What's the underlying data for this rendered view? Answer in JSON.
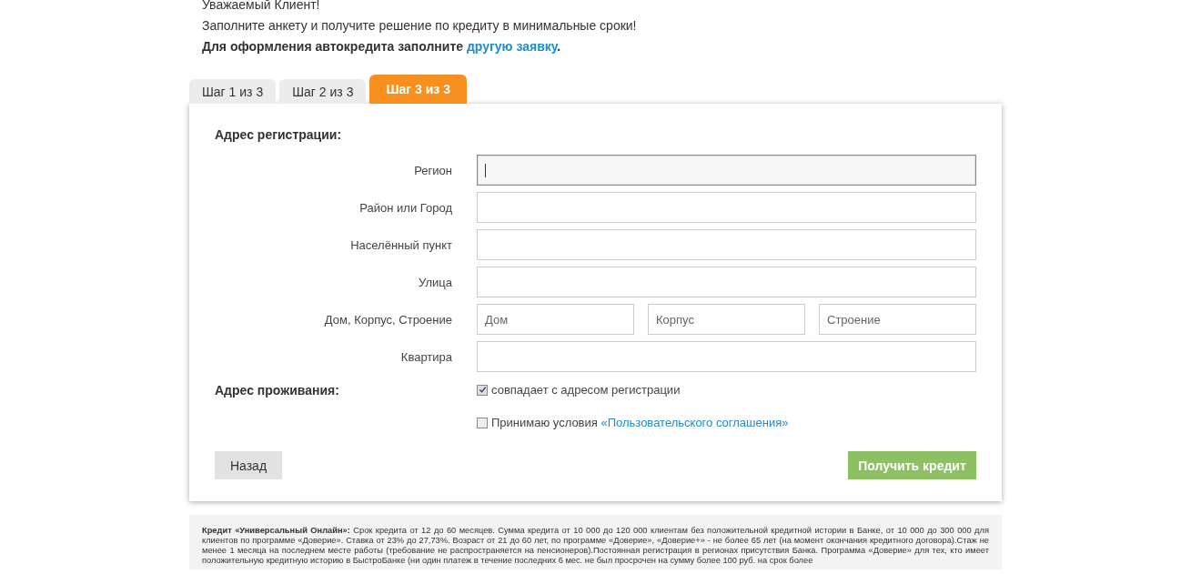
{
  "greeting": "Уважаемый Клиент!",
  "intro": "Заполните анкету и получите решение по кредиту в минимальные сроки!",
  "auto_note": {
    "text": "Для оформления автокредита заполните",
    "link": "другую заявку",
    "end": "."
  },
  "tabs": [
    {
      "label": "Шаг 1 из 3",
      "selected": false
    },
    {
      "label": "Шаг 2 из 3",
      "selected": false
    },
    {
      "label": "Шаг 3 из 3",
      "selected": true
    }
  ],
  "registration": {
    "title": "Адрес регистрации:",
    "fields": [
      {
        "label": "Регион",
        "kind": "single",
        "focused": true
      },
      {
        "label": "Район или Город",
        "kind": "single",
        "focused": false
      },
      {
        "label": "Населённый пункт",
        "kind": "single",
        "focused": false
      },
      {
        "label": "Улица",
        "kind": "single",
        "focused": false
      },
      {
        "label": "Дом, Корпус, Строение",
        "kind": "triple",
        "placeholders": [
          "Дом",
          "Корпус",
          "Строение"
        ]
      },
      {
        "label": "Квартира",
        "kind": "single",
        "focused": false
      }
    ]
  },
  "residence": {
    "title": "Адрес проживания:",
    "same_as_registration": {
      "label": "совпадает с адресом регистрации",
      "checked": true
    }
  },
  "agreement": {
    "label": "Принимаю условия",
    "link": "«Пользовательского соглашения»",
    "checked": false
  },
  "buttons": {
    "back": "Назад",
    "submit": "Получить кредит"
  },
  "disclaimer": "**Кредит «Универсальный Онлайн»:** Срок кредита от 12 до 60 месяцев. Сумма кредита от 10 000 до 120 000 клиентам без положительной кредитной истории в Банке, от 10 000 до 300 000 для клиентов по программе «Доверие». Ставка от 23% до 27,73%. Возраст от 21 до 60 лет, по программе «Доверие», «Доверие+» - не более 65 лет (на момент окончания кредитного договора).Стаж не менее 1 месяца на последнем месте работы (требование не распространяется на пенсионеров).Постоянная регистрация в регионах присутствия Банка. Программа «Доверие» для тех, кто имеет положительную кредитную историю в БыстроБанке (ни один платеж в течение последних 6 мес. не был просрочен на сумму более 100 руб. на срок более"
}
